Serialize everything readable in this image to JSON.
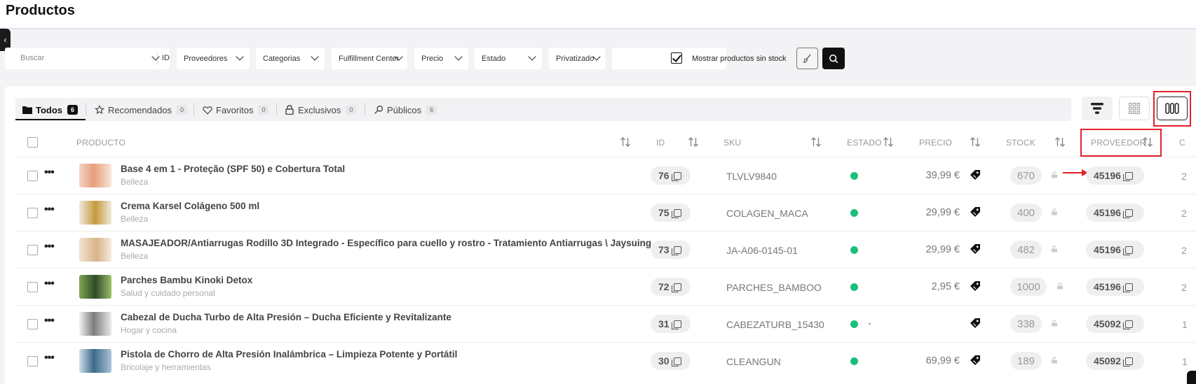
{
  "page": {
    "title": "Productos"
  },
  "filters": {
    "search_placeholder": "Buscar",
    "search_field": "ID",
    "proveedores": "Proveedores",
    "categorias": "Categorias",
    "fulfillment": "Fulfillment Center",
    "precio": "Precio",
    "estado": "Estado",
    "privatizado": "Privatizado",
    "show_no_stock": "Mostrar productos sin stock",
    "show_no_stock_checked": true
  },
  "tabs": [
    {
      "label": "Todos",
      "count": "6",
      "icon": "folder-icon"
    },
    {
      "label": "Recomendados",
      "count": "0",
      "icon": "star-icon"
    },
    {
      "label": "Favoritos",
      "count": "0",
      "icon": "heart-icon"
    },
    {
      "label": "Exclusivos",
      "count": "0",
      "icon": "lock-icon"
    },
    {
      "label": "Públicos",
      "count": "6",
      "icon": "search-icon"
    }
  ],
  "table": {
    "headers": {
      "producto": "PRODUCTO",
      "id": "ID",
      "sku": "SKU",
      "estado": "ESTADO",
      "precio": "PRECIO",
      "stock": "STOCK",
      "proveedor": "PROVEEDOR",
      "next": "C"
    },
    "rows": [
      {
        "name": "Base 4 em 1 - Proteção (SPF 50) e Cobertura Total",
        "category": "Belleza",
        "id": "76",
        "sku": "TLVLV9840",
        "price": "39,99 €",
        "stock": "670",
        "provider": "45196",
        "next": "2"
      },
      {
        "name": "Crema Karsel Colágeno 500 ml",
        "category": "Belleza",
        "id": "75",
        "sku": "COLAGEN_MACA",
        "price": "29,99 €",
        "stock": "400",
        "provider": "45196",
        "next": "2"
      },
      {
        "name": "MASAJEADOR/Antiarrugas Rodillo 3D Integrado - Específico para cuello y rostro - Tratamiento Antiarrugas \\ Jaysuing",
        "category": "Belleza",
        "id": "73",
        "sku": "JA-A06-0145-01",
        "price": "29,99 €",
        "stock": "482",
        "provider": "45196",
        "next": "2"
      },
      {
        "name": "Parches Bambu Kinoki Detox",
        "category": "Salud y cuidado personal",
        "id": "72",
        "sku": "PARCHES_BAMBOO",
        "price": "2,95 €",
        "stock": "1000",
        "provider": "45196",
        "next": "2"
      },
      {
        "name": "Cabezal de Ducha Turbo de Alta Presión – Ducha Eficiente y Revitalizante",
        "category": "Hogar y cocina",
        "id": "31",
        "sku": "CABEZATURB_15430",
        "price": "-",
        "stock": "338",
        "provider": "45092",
        "next": "1"
      },
      {
        "name": "Pistola de Chorro de Alta Presión Inalámbrica – Limpieza Potente y Portátil",
        "category": "Bricolaje y herramientas",
        "id": "30",
        "sku": "CLEANGUN",
        "price": "69,99 €",
        "stock": "189",
        "provider": "45092",
        "next": "1"
      }
    ]
  },
  "colors": {
    "status_active": "#1cbf7a",
    "highlight": "#e32129",
    "accent_dark": "#111111"
  }
}
